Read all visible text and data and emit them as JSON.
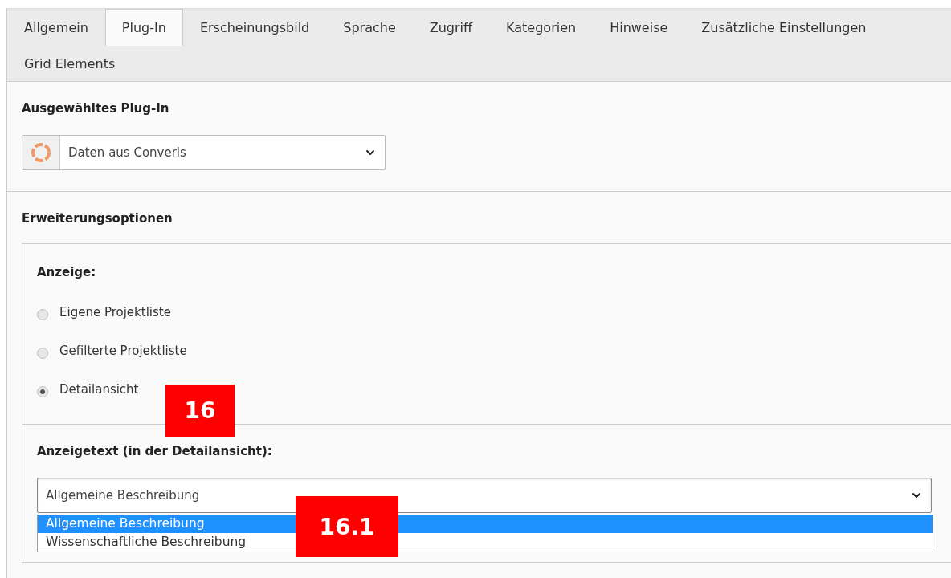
{
  "tabs": [
    {
      "label": "Allgemein",
      "selected": false
    },
    {
      "label": "Plug-In",
      "selected": true
    },
    {
      "label": "Erscheinungsbild",
      "selected": false
    },
    {
      "label": "Sprache",
      "selected": false
    },
    {
      "label": "Zugriff",
      "selected": false
    },
    {
      "label": "Kategorien",
      "selected": false
    },
    {
      "label": "Hinweise",
      "selected": false
    },
    {
      "label": "Zusätzliche Einstellungen",
      "selected": false
    },
    {
      "label": "Grid Elements",
      "selected": false
    }
  ],
  "plugin_section": {
    "heading": "Ausgewähltes Plug-In",
    "select_value": "Daten aus Converis"
  },
  "options_section": {
    "heading": "Erweiterungsoptionen",
    "display": {
      "label": "Anzeige:",
      "radios": [
        {
          "label": "Eigene Projektliste",
          "checked": false
        },
        {
          "label": "Gefilterte Projektliste",
          "checked": false
        },
        {
          "label": "Detailansicht",
          "checked": true
        }
      ]
    },
    "detail_text": {
      "label": "Anzeigetext (in der Detailansicht):",
      "select_value": "Allgemeine Beschreibung",
      "expanded": true,
      "options": [
        {
          "label": "Allgemeine Beschreibung",
          "selected": true
        },
        {
          "label": "Wissenschaftliche Beschreibung",
          "selected": false
        }
      ]
    }
  },
  "annotations": [
    {
      "label": "16"
    },
    {
      "label": "16.1"
    }
  ]
}
